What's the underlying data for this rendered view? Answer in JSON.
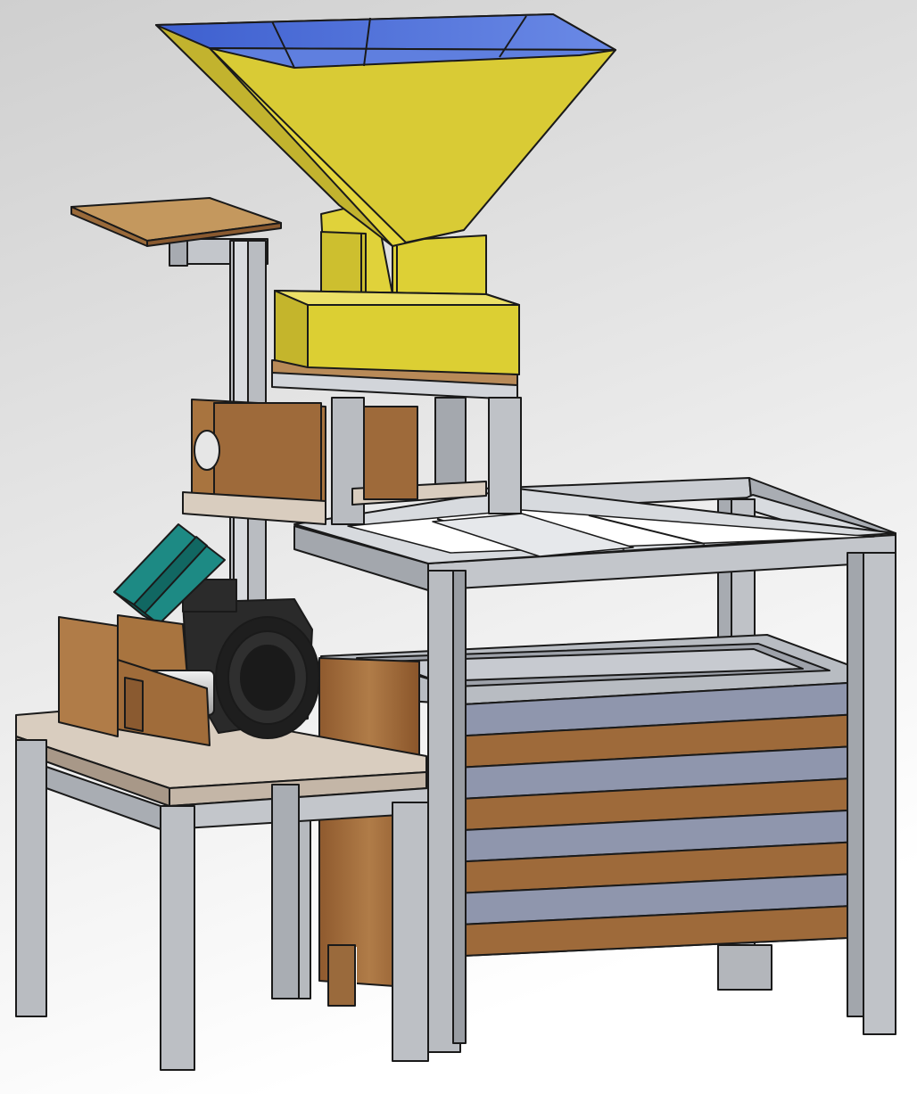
{
  "colors": {
    "background_top": "#d2d2d2",
    "background_bottom": "#ffffff",
    "frame_front": "#b8bcc2",
    "frame_side": "#9a9ea5",
    "frame_top": "#d6d9dd",
    "hopper": "#e0d23a",
    "hopper_shadow": "#b7a82a",
    "hopper_interior": "#4d6fd9",
    "wood_light": "#c89a63",
    "wood_mid": "#9e6a3a",
    "wood_dark": "#6e4220",
    "board_top": "#d9c6b3",
    "slat_blue": "#8f96ad",
    "motor_black": "#1e1e1e",
    "teal_chute": "#1d8a84",
    "roller_silver": "#cfcfcf",
    "outline": "#1a1a1a"
  },
  "icons": {
    "machine": "grain-processing-machine-icon"
  }
}
